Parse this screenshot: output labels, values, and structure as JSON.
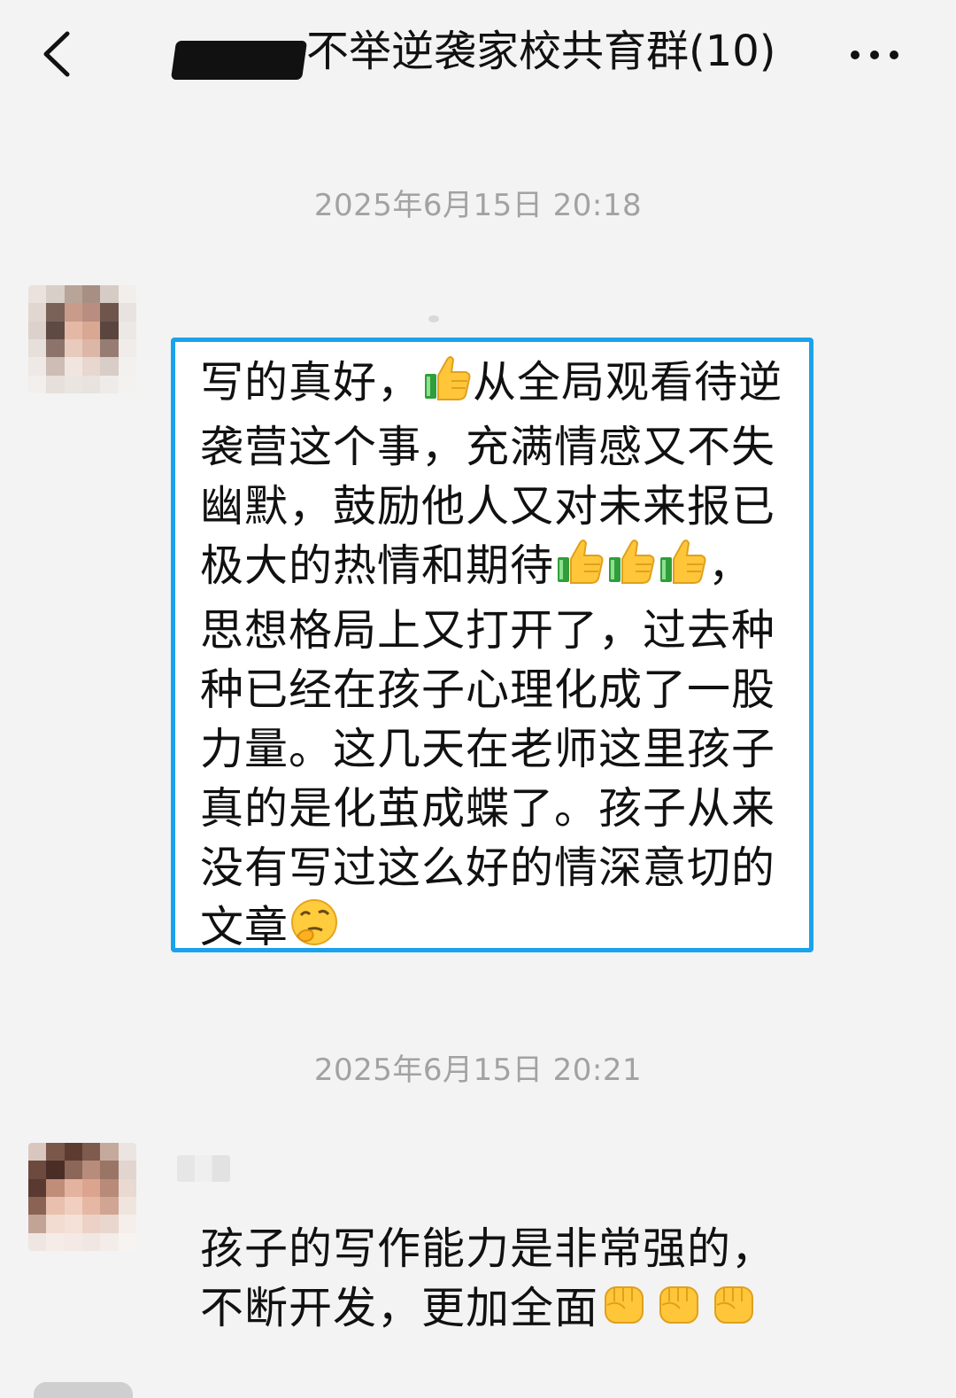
{
  "header": {
    "title": "不举逆袭家校共育群(10)",
    "back_icon": "chevron-left-icon",
    "more_icon": "more-horizontal-icon"
  },
  "messages": [
    {
      "timestamp": "2025年6月15日 20:18",
      "highlighted": true,
      "lines": [
        [
          "写的真好，",
          "thumbs-up",
          "从全局观看待逆"
        ],
        [
          "袭营这个事，充满情感又不失"
        ],
        [
          "幽默，鼓励他人又对未来报已"
        ],
        [
          "极大的热情和期待",
          "thumbs-up",
          "thumbs-up",
          "thumbs-up",
          "，"
        ],
        [
          "思想格局上又打开了，过去种"
        ],
        [
          "种已经在孩子心理化成了一股"
        ],
        [
          "力量。这几天在老师这里孩子"
        ],
        [
          "真的是化茧成蝶了。孩子从来"
        ],
        [
          "没有写过这么好的情深意切的"
        ],
        [
          "文章",
          "thinking-face"
        ]
      ]
    },
    {
      "timestamp": "2025年6月15日 20:21",
      "highlighted": false,
      "lines": [
        [
          "孩子的写作能力是非常强的，"
        ],
        [
          "不断开发，更加全面",
          "raised-fist",
          "raised-fist",
          "raised-fist"
        ]
      ]
    }
  ],
  "colors": {
    "background": "#f3f3f3",
    "highlight_border": "#1aa3ec",
    "timestamp": "#a2a2a2",
    "text": "#111111"
  }
}
